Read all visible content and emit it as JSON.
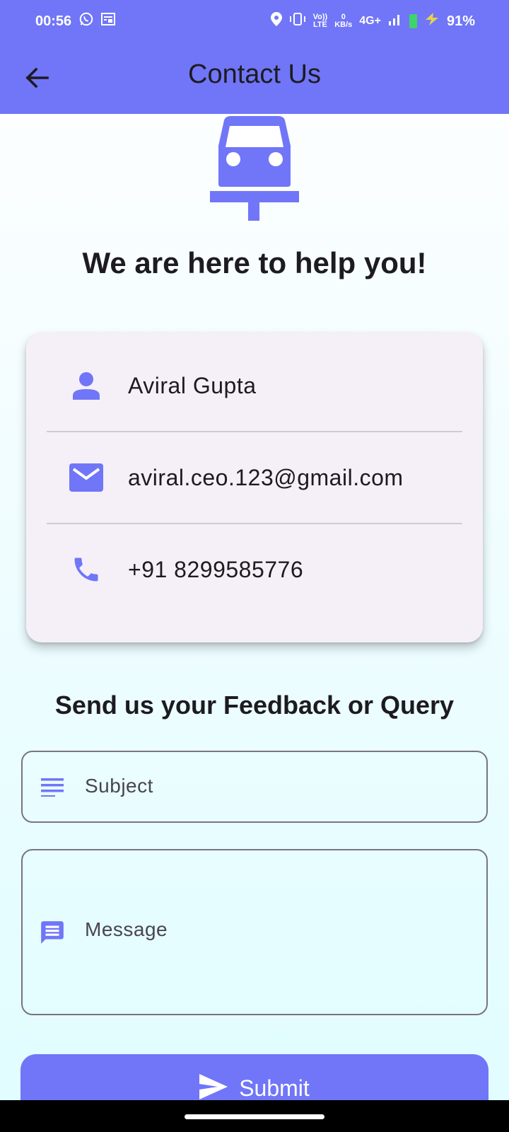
{
  "status_bar": {
    "time": "00:56",
    "network_speed_value": "0",
    "network_speed_unit": "KB/s",
    "volte_top": "Vo))",
    "volte_bottom": "LTE",
    "network_type": "4G+",
    "battery": "91%"
  },
  "app_bar": {
    "title": "Contact Us"
  },
  "hero": {
    "title": "We are here to help you!",
    "icon": "car-on-lift-icon"
  },
  "contact": {
    "name": "Aviral Gupta",
    "email": "aviral.ceo.123@gmail.com",
    "phone": "+91 8299585776"
  },
  "feedback": {
    "title": "Send us your Feedback or Query",
    "subject_placeholder": "Subject",
    "message_placeholder": "Message",
    "submit_label": "Submit"
  },
  "colors": {
    "primary": "#7076f7",
    "card_bg": "#f5f0f8",
    "outline": "#79747e"
  }
}
